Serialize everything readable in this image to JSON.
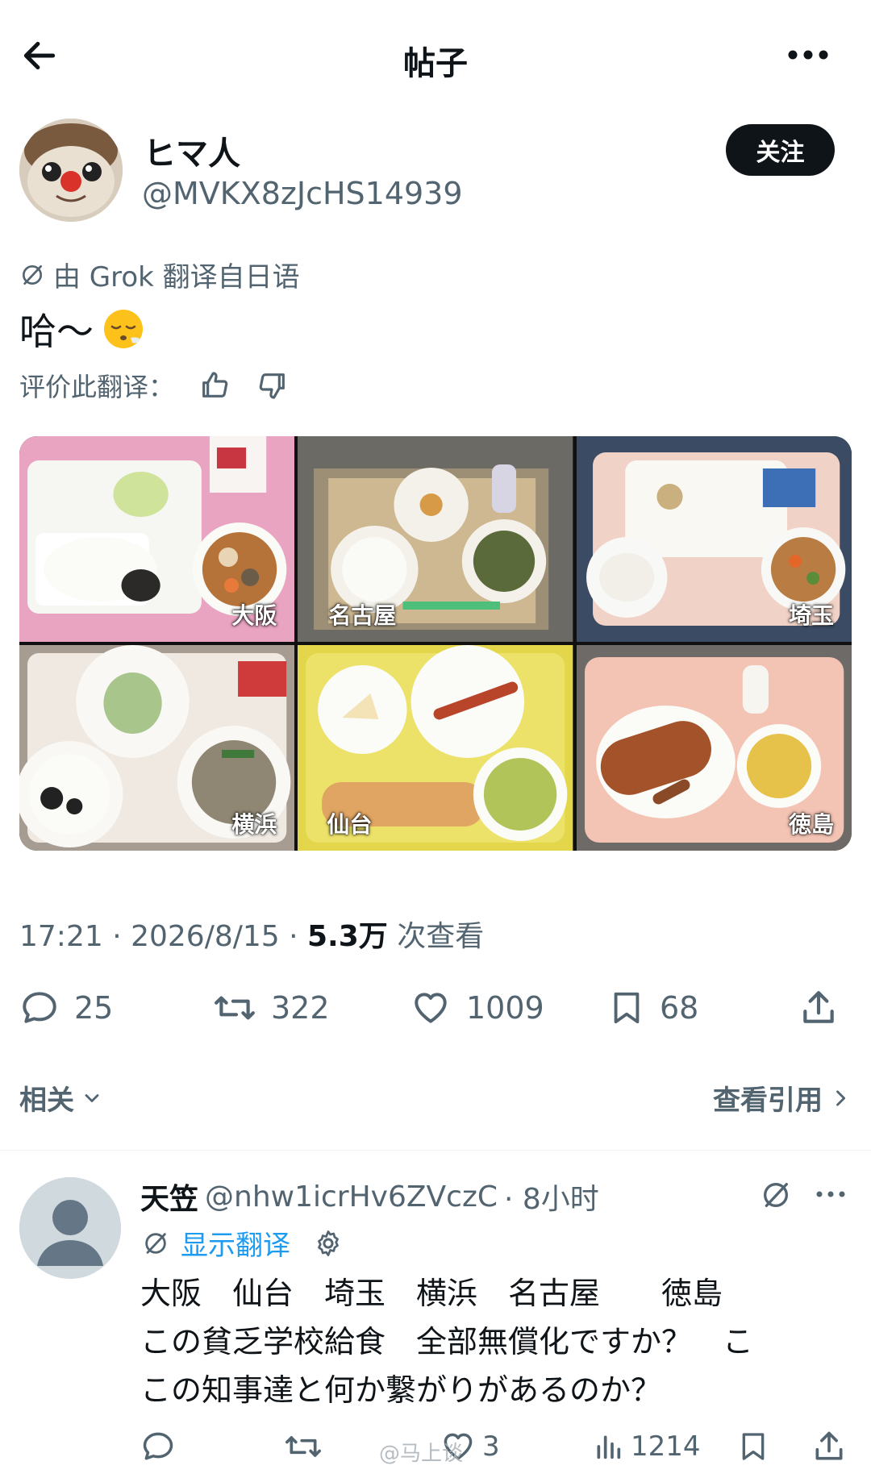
{
  "header": {
    "title": "帖子"
  },
  "post": {
    "author_name": "ヒマ人",
    "author_handle": "@MVKX8zJcHS14939",
    "follow_label": "关注",
    "translation_note": "由 Grok 翻译自日语",
    "text": "哈～",
    "emoji": "😮‍💨",
    "rate_label": "评价此翻译：",
    "photos": [
      {
        "label": "大阪"
      },
      {
        "label": "名古屋"
      },
      {
        "label": "埼玉"
      },
      {
        "label": "横浜"
      },
      {
        "label": "仙台"
      },
      {
        "label": "徳島"
      }
    ],
    "meta": {
      "time": "17:21 · 2026/8/15 · ",
      "views": "5.3万",
      "views_suffix": " 次查看"
    },
    "stats": {
      "replies": "25",
      "reposts": "322",
      "likes": "1009",
      "bookmarks": "68"
    }
  },
  "links": {
    "related": "相关",
    "view_quotes": "查看引用"
  },
  "reply": {
    "name": "天笠",
    "handle": "@nhw1icrHv6ZVczC",
    "time": "· 8小时",
    "show_translation": "显示翻译",
    "text": "大阪　仙台　埼玉　横浜　名古屋　　徳島\nこの貧乏学校給食　全部無償化ですか？　こ\nこの知事達と何か繋がりがあるのか？",
    "stats": {
      "likes": "3",
      "views": "1214"
    }
  },
  "watermark": "@马上谈",
  "colors": {
    "text": "#0f1419",
    "muted": "#536471",
    "link": "#1d9bf0",
    "button": "#0f1419"
  }
}
